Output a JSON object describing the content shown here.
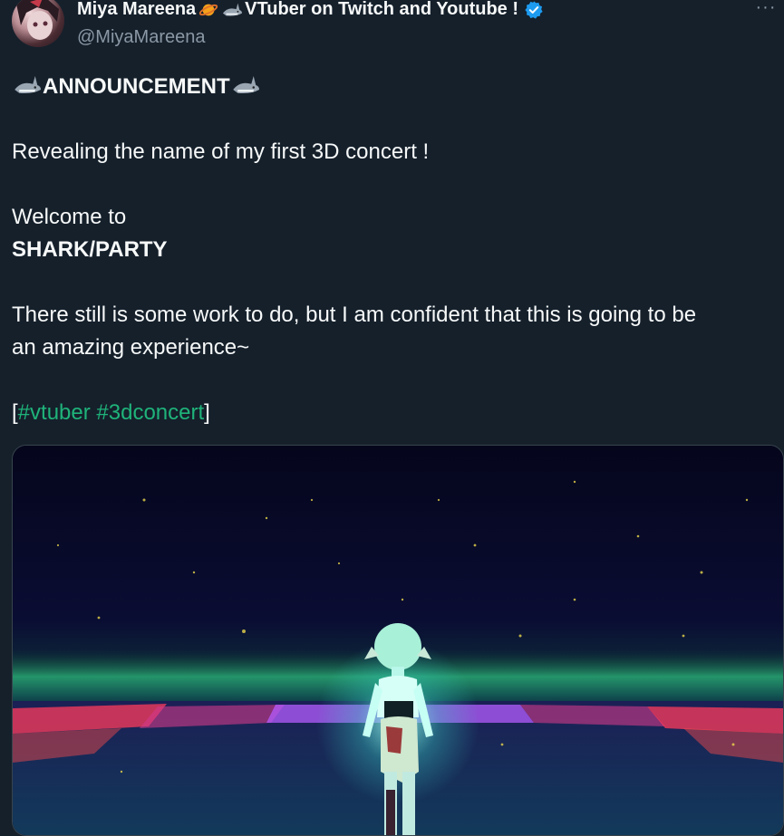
{
  "tweet": {
    "author": {
      "display_name": "Miya Mareena",
      "name_suffix": " VTuber on Twitch and Youtube !",
      "handle": "@MiyaMareena",
      "verified": true,
      "avatar_icon": "avatar-image"
    },
    "more_icon": "more-options-icon",
    "body": {
      "announcement": "ANNOUNCEMENT",
      "line1": "Revealing the name of my first 3D concert !",
      "line2": "Welcome to",
      "line3": "SHARK/PARTY",
      "line4": "There still is some work to do, but I am confident that this is going to be",
      "line5": "an amazing experience~",
      "bracket_open": "[",
      "hashtag1": "#vtuber",
      "hashtag2": "#3dconcert",
      "bracket_close": "]"
    },
    "media": {
      "type": "image",
      "description_icon": "concert-stage-image"
    }
  },
  "colors": {
    "background": "#15202b",
    "text": "#f7f9f9",
    "secondary_text": "#8b98a5",
    "hashtag": "#1fb37a",
    "verified": "#1d9bf0"
  },
  "icons": [
    "planet-emoji-icon",
    "shark-emoji-icon",
    "verified-badge-icon",
    "more-options-icon"
  ]
}
